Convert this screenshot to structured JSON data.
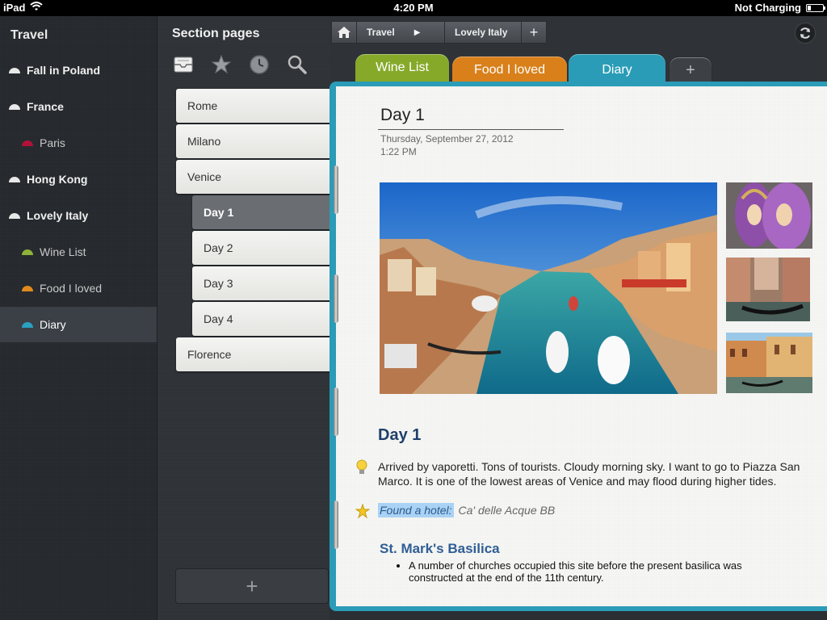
{
  "status_bar": {
    "device": "iPad",
    "time": "4:20 PM",
    "battery_status": "Not Charging"
  },
  "sidebar": {
    "title": "Travel",
    "items": [
      {
        "label": "Fall in Poland",
        "level": 0,
        "color": "#e8e8e8",
        "selected": false
      },
      {
        "label": "France",
        "level": 0,
        "color": "#e8e8e8",
        "selected": false
      },
      {
        "label": "Paris",
        "level": 1,
        "color": "#b0123a",
        "selected": false
      },
      {
        "label": "Hong Kong",
        "level": 0,
        "color": "#e8e8e8",
        "selected": false
      },
      {
        "label": "Lovely Italy",
        "level": 0,
        "color": "#e8e8e8",
        "selected": false
      },
      {
        "label": "Wine List",
        "level": 1,
        "color": "#8db33a",
        "selected": false
      },
      {
        "label": "Food I loved",
        "level": 1,
        "color": "#e08a1e",
        "selected": false
      },
      {
        "label": "Diary",
        "level": 1,
        "color": "#2aa0c2",
        "selected": true
      }
    ]
  },
  "section_pages": {
    "title": "Section pages",
    "tools": [
      "notebook-icon",
      "star-icon",
      "clock-icon",
      "search-icon"
    ],
    "pages": [
      {
        "label": "Rome",
        "level": 0,
        "selected": false
      },
      {
        "label": "Milano",
        "level": 0,
        "selected": false
      },
      {
        "label": "Venice",
        "level": 0,
        "selected": false
      },
      {
        "label": "Day 1",
        "level": 1,
        "selected": true
      },
      {
        "label": "Day 2",
        "level": 1,
        "selected": false
      },
      {
        "label": "Day 3",
        "level": 1,
        "selected": false
      },
      {
        "label": "Day 4",
        "level": 1,
        "selected": false
      },
      {
        "label": "Florence",
        "level": 0,
        "selected": false
      }
    ],
    "add_label": "+"
  },
  "breadcrumbs": {
    "items": [
      "Travel",
      "Lovely Italy"
    ],
    "add_label": "+"
  },
  "tabs": {
    "items": [
      {
        "label": "Wine List",
        "color": "#86a92a",
        "active": false
      },
      {
        "label": "Food I loved",
        "color": "#d9801b",
        "active": false
      },
      {
        "label": "Diary",
        "color": "#2a9cb7",
        "active": true
      }
    ],
    "add_label": "+"
  },
  "note": {
    "title": "Day 1",
    "date": "Thursday, September 27, 2012",
    "time": "1:22 PM",
    "heading": "Day 1",
    "paragraph": "Arrived by vaporetti. Tons of tourists. Cloudy morning sky.  I want to go to Piazza San Marco. It is one of the lowest areas of Venice and may flood during higher tides.",
    "hotel_label": "Found a hotel:",
    "hotel_name": "Ca' delle Acque BB",
    "subheading": "St. Mark's Basilica",
    "bullets": [
      "A number of churches occupied this site before the present basilica was constructed at the end of the 11th century."
    ]
  },
  "colors": {
    "accent": "#2a9cb7",
    "heading": "#1f3f6b",
    "highlight": "#a9d2f4"
  }
}
